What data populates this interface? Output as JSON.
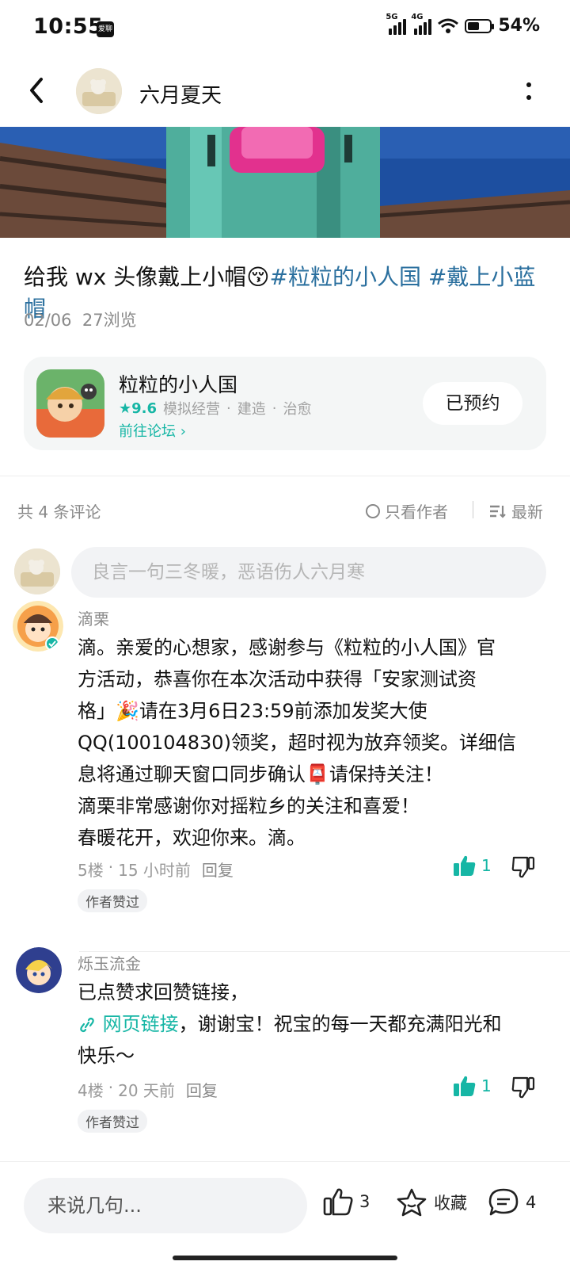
{
  "status": {
    "time": "10:55",
    "badge": "爱聊",
    "net1": "5G",
    "net2": "4G",
    "battery": "54%"
  },
  "header": {
    "author": "六月夏天",
    "back_icon": "chevron-left-icon",
    "more_icon": "more-vertical-icon"
  },
  "post": {
    "text": "给我 wx 头像戴上小帽",
    "emoji": "😚",
    "tag1": "#粒粒的小人国",
    "tag2": "#戴上小蓝帽",
    "date": "02/06",
    "views": "27浏览"
  },
  "game": {
    "name": "粒粒的小人国",
    "rating": "9.6",
    "genre1": "模拟经营",
    "genre2": "建造",
    "genre3": "治愈",
    "forum": "前往论坛",
    "reserve": "已预约"
  },
  "comments_bar": {
    "count": "共 4 条评论",
    "only_author": "只看作者",
    "latest": "最新"
  },
  "comment_input": {
    "placeholder": "良言一句三冬暖，恶语伤人六月寒"
  },
  "comments": [
    {
      "name": "滴栗",
      "lines": [
        "滴。亲爱的心想家，感谢参与《粒粒的小人国》官",
        "方活动，恭喜你在本次活动中获得「安家测试资",
        "格」🎉请在3月6日23:59前添加发奖大使",
        "QQ(100104830)领奖，超时视为放弃领奖。详细信",
        "息将通过聊天窗口同步确认📮请保持关注！",
        "滴栗非常感谢你对摇粒乡的关注和喜爱！",
        "春暖花开，欢迎你来。滴。"
      ],
      "floor": "5楼",
      "time": "15 小时前",
      "reply": "回复",
      "likes": "1",
      "badge": "作者赞过"
    },
    {
      "name": "烁玉流金",
      "line1": "已点赞求回赞链接，",
      "link": "网页链接",
      "line2_rest": "，谢谢宝！祝宝的每一天都充满阳光和",
      "line3": "快乐～",
      "floor": "4楼",
      "time": "20 天前",
      "reply": "回复",
      "likes": "1",
      "badge": "作者赞过"
    }
  ],
  "bottom": {
    "placeholder": "来说几句...",
    "likes": "3",
    "favorite": "收藏",
    "comments": "4"
  },
  "colors": {
    "accent": "#16b6a5",
    "tag": "#2a6f9e"
  }
}
